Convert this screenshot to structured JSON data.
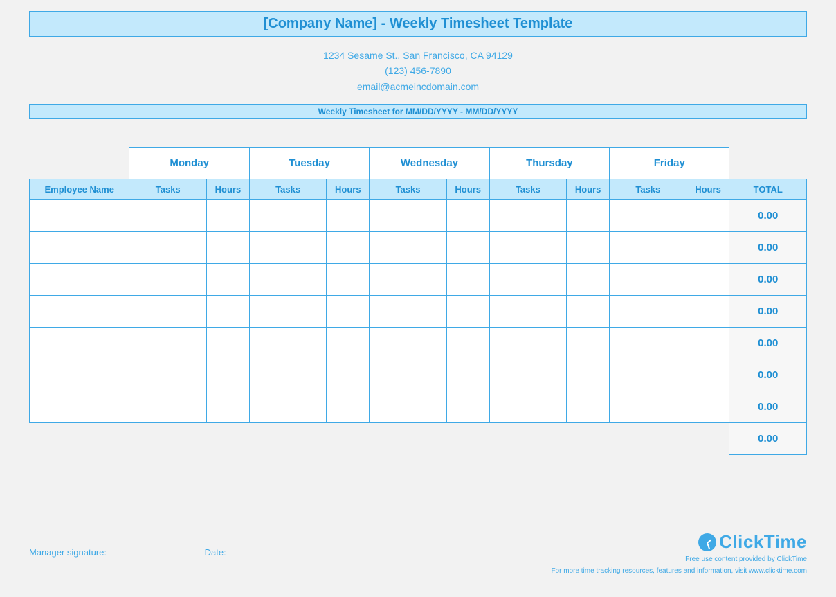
{
  "header": {
    "title": "[Company Name] - Weekly Timesheet Template",
    "address": "1234 Sesame St.,  San Francisco, CA 94129",
    "phone": "(123) 456-7890",
    "email": "email@acmeincdomain.com",
    "week_label": "Weekly Timesheet for MM/DD/YYYY - MM/DD/YYYY"
  },
  "columns": {
    "employee": "Employee Name",
    "days": [
      "Monday",
      "Tuesday",
      "Wednesday",
      "Thursday",
      "Friday"
    ],
    "tasks_label": "Tasks",
    "hours_label": "Hours",
    "total_label": "TOTAL"
  },
  "rows": [
    {
      "employee": "",
      "cells": [
        "",
        "",
        "",
        "",
        "",
        "",
        "",
        "",
        "",
        ""
      ],
      "total": "0.00"
    },
    {
      "employee": "",
      "cells": [
        "",
        "",
        "",
        "",
        "",
        "",
        "",
        "",
        "",
        ""
      ],
      "total": "0.00"
    },
    {
      "employee": "",
      "cells": [
        "",
        "",
        "",
        "",
        "",
        "",
        "",
        "",
        "",
        ""
      ],
      "total": "0.00"
    },
    {
      "employee": "",
      "cells": [
        "",
        "",
        "",
        "",
        "",
        "",
        "",
        "",
        "",
        ""
      ],
      "total": "0.00"
    },
    {
      "employee": "",
      "cells": [
        "",
        "",
        "",
        "",
        "",
        "",
        "",
        "",
        "",
        ""
      ],
      "total": "0.00"
    },
    {
      "employee": "",
      "cells": [
        "",
        "",
        "",
        "",
        "",
        "",
        "",
        "",
        "",
        ""
      ],
      "total": "0.00"
    },
    {
      "employee": "",
      "cells": [
        "",
        "",
        "",
        "",
        "",
        "",
        "",
        "",
        "",
        ""
      ],
      "total": "0.00"
    }
  ],
  "grand_total": "0.00",
  "signature": {
    "manager_label": "Manager signature:",
    "date_label": "Date:"
  },
  "brand": {
    "name": "ClickTime",
    "tag1": "Free use content provided by ClickTime",
    "tag2": "For more time tracking resources, features and information, visit www.clicktime.com"
  }
}
